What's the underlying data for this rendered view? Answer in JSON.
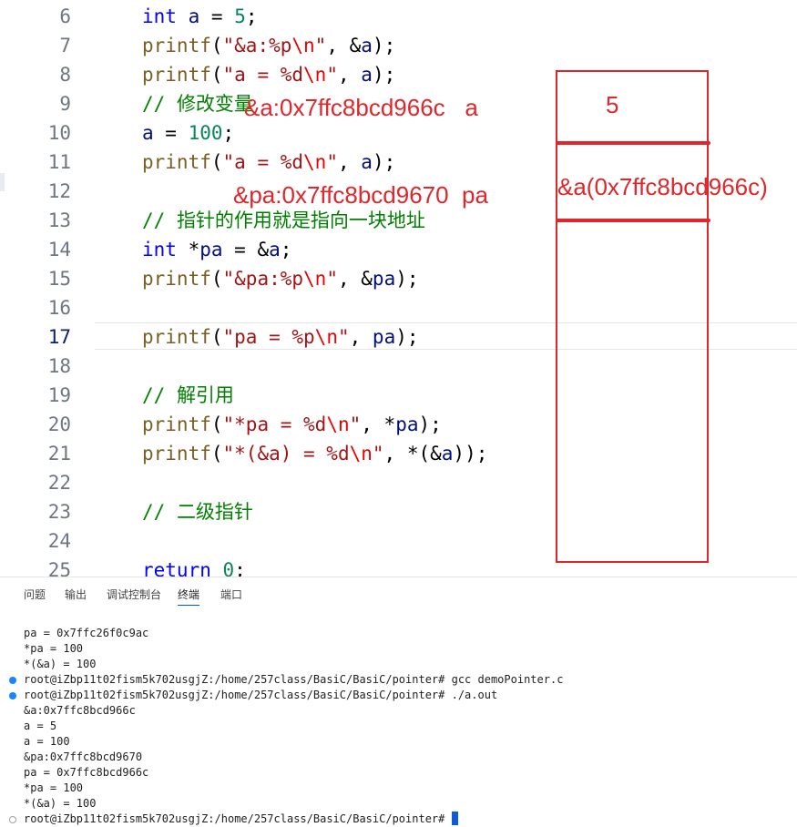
{
  "editor": {
    "current_line": "17",
    "lines": [
      {
        "num": "6",
        "tokens": [
          [
            "kw",
            "int"
          ],
          [
            "pn",
            " "
          ],
          [
            "var",
            "a"
          ],
          [
            "pn",
            " = "
          ],
          [
            "num",
            "5"
          ],
          [
            "pn",
            ";"
          ]
        ]
      },
      {
        "num": "7",
        "tokens": [
          [
            "fn",
            "printf"
          ],
          [
            "pn",
            "("
          ],
          [
            "str",
            "\"&a:%p"
          ],
          [
            "esc",
            "\\n"
          ],
          [
            "str",
            "\""
          ],
          [
            "pn",
            ", &"
          ],
          [
            "var",
            "a"
          ],
          [
            "pn",
            ");"
          ]
        ]
      },
      {
        "num": "8",
        "tokens": [
          [
            "fn",
            "printf"
          ],
          [
            "pn",
            "("
          ],
          [
            "str",
            "\"a = %d"
          ],
          [
            "esc",
            "\\n"
          ],
          [
            "str",
            "\""
          ],
          [
            "pn",
            ", "
          ],
          [
            "var",
            "a"
          ],
          [
            "pn",
            ");"
          ]
        ]
      },
      {
        "num": "9",
        "tokens": [
          [
            "cm",
            "// "
          ],
          [
            "cmcn",
            "修改变量"
          ]
        ]
      },
      {
        "num": "10",
        "tokens": [
          [
            "var",
            "a"
          ],
          [
            "pn",
            " = "
          ],
          [
            "num",
            "100"
          ],
          [
            "pn",
            ";"
          ]
        ]
      },
      {
        "num": "11",
        "tokens": [
          [
            "fn",
            "printf"
          ],
          [
            "pn",
            "("
          ],
          [
            "str",
            "\"a = %d"
          ],
          [
            "esc",
            "\\n"
          ],
          [
            "str",
            "\""
          ],
          [
            "pn",
            ", "
          ],
          [
            "var",
            "a"
          ],
          [
            "pn",
            ");"
          ]
        ]
      },
      {
        "num": "12",
        "tokens": []
      },
      {
        "num": "13",
        "tokens": [
          [
            "cm",
            "// "
          ],
          [
            "cmcn",
            "指针的作用就是指向一块地址"
          ]
        ]
      },
      {
        "num": "14",
        "tokens": [
          [
            "kw",
            "int"
          ],
          [
            "pn",
            " *"
          ],
          [
            "var",
            "pa"
          ],
          [
            "pn",
            " = &"
          ],
          [
            "var",
            "a"
          ],
          [
            "pn",
            ";"
          ]
        ]
      },
      {
        "num": "15",
        "tokens": [
          [
            "fn",
            "printf"
          ],
          [
            "pn",
            "("
          ],
          [
            "str",
            "\"&pa:%p"
          ],
          [
            "esc",
            "\\n"
          ],
          [
            "str",
            "\""
          ],
          [
            "pn",
            ", &"
          ],
          [
            "var",
            "pa"
          ],
          [
            "pn",
            ");"
          ]
        ]
      },
      {
        "num": "16",
        "tokens": []
      },
      {
        "num": "17",
        "tokens": [
          [
            "fn",
            "printf"
          ],
          [
            "pn",
            "("
          ],
          [
            "str",
            "\"pa = %p"
          ],
          [
            "esc",
            "\\n"
          ],
          [
            "str",
            "\""
          ],
          [
            "pn",
            ", "
          ],
          [
            "var",
            "pa"
          ],
          [
            "pn",
            ");"
          ]
        ]
      },
      {
        "num": "18",
        "tokens": []
      },
      {
        "num": "19",
        "tokens": [
          [
            "cm",
            "// "
          ],
          [
            "cmcn",
            "解引用"
          ]
        ]
      },
      {
        "num": "20",
        "tokens": [
          [
            "fn",
            "printf"
          ],
          [
            "pn",
            "("
          ],
          [
            "str",
            "\"*pa = %d"
          ],
          [
            "esc",
            "\\n"
          ],
          [
            "str",
            "\""
          ],
          [
            "pn",
            ", *"
          ],
          [
            "var",
            "pa"
          ],
          [
            "pn",
            ");"
          ]
        ]
      },
      {
        "num": "21",
        "tokens": [
          [
            "fn",
            "printf"
          ],
          [
            "pn",
            "("
          ],
          [
            "str",
            "\"*(&a) = %d"
          ],
          [
            "esc",
            "\\n"
          ],
          [
            "str",
            "\""
          ],
          [
            "pn",
            ", *(&"
          ],
          [
            "var",
            "a"
          ],
          [
            "pn",
            "));"
          ]
        ]
      },
      {
        "num": "22",
        "tokens": []
      },
      {
        "num": "23",
        "tokens": [
          [
            "cm",
            "// "
          ],
          [
            "cmcn",
            "二级指针"
          ]
        ]
      },
      {
        "num": "24",
        "tokens": []
      },
      {
        "num": "25",
        "tokens": [
          [
            "kw",
            "return"
          ],
          [
            "pn",
            " "
          ],
          [
            "num",
            "0"
          ],
          [
            "pn",
            ";"
          ]
        ]
      }
    ]
  },
  "annotations": {
    "addr_a": "&a:0x7ffc8bcd966c   a",
    "addr_pa": "&pa:0x7ffc8bcd9670  pa",
    "mem_value": "5",
    "mem_pointer": "&a(0x7ffc8bcd966c)"
  },
  "panel": {
    "tabs": [
      "问题",
      "输出",
      "调试控制台",
      "终端",
      "端口"
    ],
    "active_tab": "终端",
    "terminal": [
      {
        "text": "pa = 0x7ffc26f0c9ac",
        "dot": ""
      },
      {
        "text": "*pa = 100",
        "dot": ""
      },
      {
        "text": "*(&a) = 100",
        "dot": ""
      },
      {
        "text": "root@iZbp11t02fism5k702usgjZ:/home/257class/BasiC/BasiC/pointer# gcc demoPointer.c",
        "dot": "filled"
      },
      {
        "text": "root@iZbp11t02fism5k702usgjZ:/home/257class/BasiC/BasiC/pointer# ./a.out",
        "dot": "filled"
      },
      {
        "text": "&a:0x7ffc8bcd966c",
        "dot": ""
      },
      {
        "text": "a = 5",
        "dot": ""
      },
      {
        "text": "a = 100",
        "dot": ""
      },
      {
        "text": "&pa:0x7ffc8bcd9670",
        "dot": ""
      },
      {
        "text": "pa = 0x7ffc8bcd966c",
        "dot": ""
      },
      {
        "text": "*pa = 100",
        "dot": ""
      },
      {
        "text": "*(&a) = 100",
        "dot": ""
      },
      {
        "text": "root@iZbp11t02fism5k702usgjZ:/home/257class/BasiC/BasiC/pointer# ",
        "dot": "hollow",
        "cursor": true
      }
    ]
  },
  "colors": {
    "annotation_red": "#e0262a",
    "keyword": "#0000ff",
    "function": "#795e26",
    "string": "#a31515",
    "escape": "#ee0000",
    "variable": "#001080",
    "number": "#098658",
    "comment": "#008000",
    "active_tab_underline": "#005fb8",
    "terminal_dot": "#1a85ff",
    "cursor": "#0f5bd6"
  }
}
